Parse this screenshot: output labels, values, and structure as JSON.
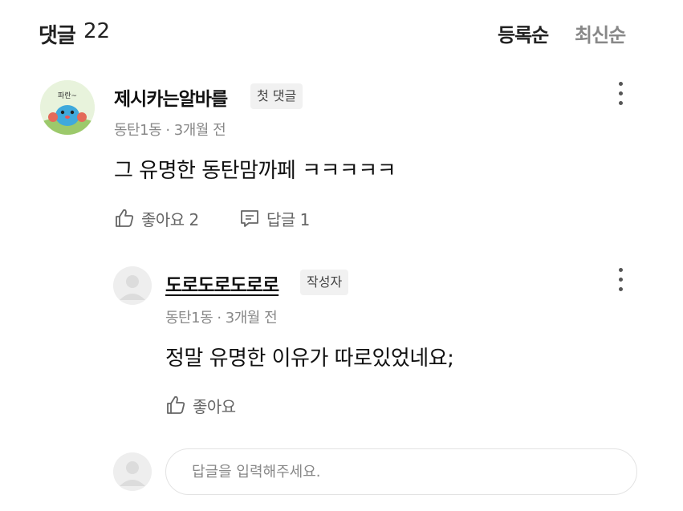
{
  "header": {
    "title": "댓글",
    "count": "22",
    "sort_registered": "등록순",
    "sort_latest": "최신순"
  },
  "comment": {
    "avatar_icon": "cartoon-character-avatar",
    "avatar_text": "파란~",
    "author": "제시카는알바를",
    "badge": "첫 댓글",
    "meta": "동탄1동 · 3개월 전",
    "text": "그 유명한 동탄맘까페 ㅋㅋㅋㅋㅋ",
    "like_label": "좋아요 2",
    "reply_label": "답글 1"
  },
  "reply": {
    "author": "도로도로도로로",
    "badge": "작성자",
    "meta": "동탄1동 · 3개월 전",
    "text": "정말 유명한 이유가 따로있었네요;",
    "like_label": "좋아요"
  },
  "reply_input": {
    "placeholder": "답글을 입력해주세요."
  },
  "colors": {
    "text_primary": "#111111",
    "text_secondary": "#888888",
    "badge_bg": "#f1f1f1",
    "avatar_placeholder": "#eeeeee"
  }
}
